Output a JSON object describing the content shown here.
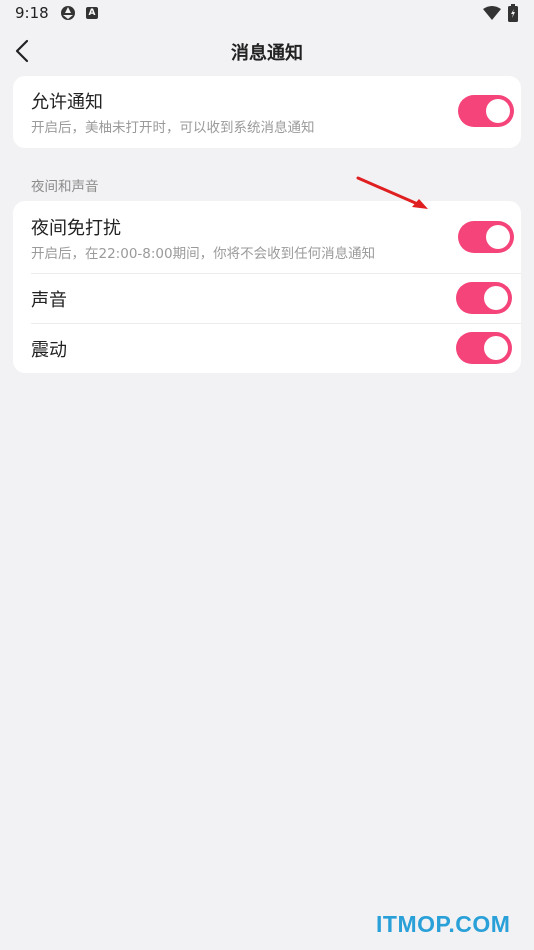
{
  "status_bar": {
    "time": "9:18",
    "icon_b": "A"
  },
  "nav": {
    "title": "消息通知"
  },
  "allow_notifications": {
    "title": "允许通知",
    "subtitle": "开启后，美柚未打开时，可以收到系统消息通知",
    "enabled": true
  },
  "night_section": {
    "label": "夜间和声音",
    "items": [
      {
        "title": "夜间免打扰",
        "subtitle": "开启后，在22:00-8:00期间，你将不会收到任何消息通知",
        "enabled": true
      },
      {
        "title": "声音",
        "enabled": true
      },
      {
        "title": "震动",
        "enabled": true
      }
    ]
  },
  "watermark": "ITMOP.COM",
  "colors": {
    "accent": "#f5447a",
    "background": "#f2f2f5",
    "card": "#ffffff",
    "arrow": "#e02020"
  }
}
